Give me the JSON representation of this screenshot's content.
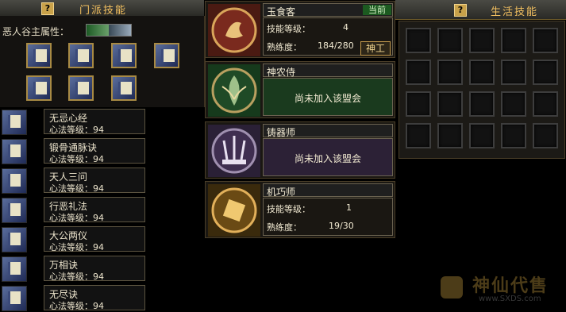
{
  "left_panel": {
    "title": "门派技能",
    "help_label": "?",
    "attribute_label": "恶人谷主属性：",
    "skills": [
      {
        "name": "无忌心经",
        "level": "心法等级：94"
      },
      {
        "name": "锻骨通脉诀",
        "level": "心法等级：94"
      },
      {
        "name": "天人三问",
        "level": "心法等级：94"
      },
      {
        "name": "行恶礼法",
        "level": "心法等级：94"
      },
      {
        "name": "大公两仪",
        "level": "心法等级：94"
      },
      {
        "name": "万相诀",
        "level": "心法等级：94"
      },
      {
        "name": "无尽诀",
        "level": "心法等级：94"
      }
    ]
  },
  "professions": [
    {
      "name": "玉食客",
      "current_badge": "当前",
      "level_label": "技能等级：",
      "level_value": "4",
      "exp_label": "熟练度：",
      "exp_value": "184/280",
      "master_button": "神工",
      "color": "#7a2a1e"
    },
    {
      "name": "神农侍",
      "not_joined": "尚未加入该盟会",
      "color": "#1f4a26"
    },
    {
      "name": "铸器师",
      "not_joined": "尚未加入该盟会",
      "color": "#3f2e50"
    },
    {
      "name": "机巧师",
      "level_label": "技能等级：",
      "level_value": "1",
      "exp_label": "熟练度：",
      "exp_value": "19/30",
      "color": "#6a4a14"
    }
  ],
  "right_panel": {
    "title": "生活技能",
    "help_label": "?",
    "slot_rows": 4,
    "slot_cols": 5
  },
  "watermark": {
    "text": "神仙代售",
    "url_text": "www.SXDS.com"
  }
}
